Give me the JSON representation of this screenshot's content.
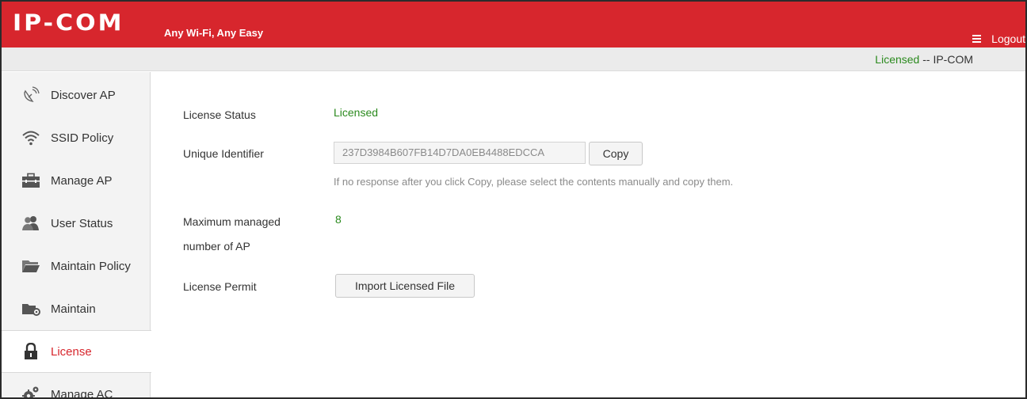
{
  "header": {
    "logo": "IP-COM",
    "slogan": "Any Wi-Fi, Any Easy",
    "logout_label": "Logout",
    "brand_color": "#d7262d"
  },
  "statusbar": {
    "license_state": "Licensed",
    "separator_vendor": " -- IP-COM"
  },
  "sidebar": {
    "items": [
      {
        "label": "Discover AP",
        "icon": "satellite-dish-icon"
      },
      {
        "label": "SSID Policy",
        "icon": "wifi-icon"
      },
      {
        "label": "Manage AP",
        "icon": "toolbox-icon"
      },
      {
        "label": "User Status",
        "icon": "users-icon"
      },
      {
        "label": "Maintain Policy",
        "icon": "folder-icon"
      },
      {
        "label": "Maintain",
        "icon": "folder-gear-icon"
      },
      {
        "label": "License",
        "icon": "lock-icon",
        "active": true
      },
      {
        "label": "Manage AC",
        "icon": "gears-icon"
      }
    ]
  },
  "main": {
    "license_status_label": "License Status",
    "license_status_value": "Licensed",
    "uid_label": "Unique Identifier",
    "uid_value": "237D3984B607FB14D7DA0EB4488EDCCA",
    "copy_label": "Copy",
    "copy_hint": "If no response after you click Copy, please select the contents manually and copy them.",
    "max_ap_label_line1": "Maximum managed",
    "max_ap_label_line2": "number of AP",
    "max_ap_value": "8",
    "permit_label": "License Permit",
    "import_label": "Import Licensed File"
  }
}
